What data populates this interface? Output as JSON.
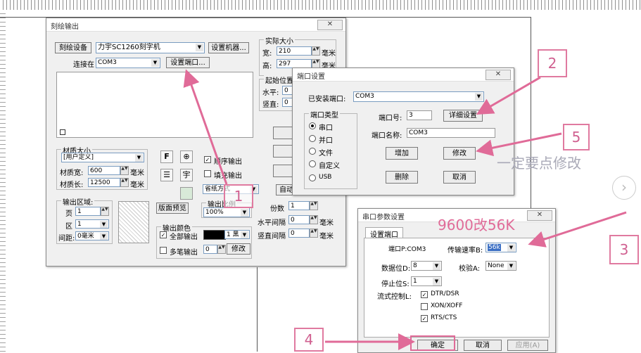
{
  "engrave_dialog": {
    "title": "刻绘输出",
    "device_button": "刻绘设备",
    "device_value": "力宇SC1260刻字机",
    "setup_machine_button": "设置机器...",
    "connect_label": "连接在",
    "port_value": "COM3",
    "setup_port_button": "设置端口...",
    "actual_size_title": "实际大小",
    "width_label": "宽:",
    "width_value": "210",
    "height_label": "高:",
    "height_value": "297",
    "unit_mm": "毫米",
    "start_pos_title": "起始位置",
    "horizontal_label": "水平:",
    "horizontal_value": "0",
    "vertical_label": "竖直:",
    "vertical_value": "0",
    "material_title": "材质大小",
    "material_value": "[用户定义]",
    "material_width_label": "材质宽:",
    "material_width_value": "600",
    "material_length_label": "材质长:",
    "material_length_value": "12500",
    "output_area_title": "输出区域:",
    "page_label": "页",
    "page_value": "1",
    "zone_label": "区",
    "zone_value": "1",
    "gap_label": "间距:",
    "gap_value": "0毫米",
    "preview_button": "版面预览",
    "icon_f": "F",
    "seq_output": "顺序输出",
    "fill_output": "填充输出",
    "icon_letter": "宇",
    "mode_value": "省纸方式",
    "ratio_title": "输出比例",
    "ratio_value": "100%",
    "auto_label": "自动",
    "copies_label": "份数",
    "copies_value": "1",
    "h_gap_label": "水平间隔",
    "h_gap_value": "0",
    "v_gap_label": "竖直间隔",
    "v_gap_value": "0",
    "color_title": "输出颜色",
    "all_output": "全部输出",
    "color_value": "1 黑",
    "multi_output": "多笔输出",
    "multi_value": "0",
    "modify_button": "修改",
    "side_btn1": "刻",
    "side_btn2": "刻绘",
    "side_btn3": "结"
  },
  "port_dialog": {
    "title": "端口设置",
    "installed_label": "已安装端口:",
    "installed_value": "COM3",
    "port_type_title": "端口类型",
    "types": [
      "串口",
      "并口",
      "文件",
      "自定义",
      "USB"
    ],
    "port_no_label": "端口号:",
    "port_no_value": "3",
    "detail_button": "详细设置",
    "port_name_label": "端口名称:",
    "port_name_value": "COM3",
    "add_button": "增加",
    "modify_button": "修改",
    "delete_button": "删除",
    "cancel_button": "取消"
  },
  "serial_dialog": {
    "title": "串口参数设置",
    "tab": "设置端口",
    "port_label": "端口P:COM3",
    "baud_label": "传输速率B:",
    "baud_value": "56k",
    "data_bits_label": "数据位D:",
    "data_bits_value": "8",
    "parity_label": "校验A:",
    "parity_value": "None",
    "stop_bits_label": "停止位S:",
    "stop_bits_value": "1",
    "flow_label": "流式控制L:",
    "flow_options": [
      "DTR/DSR",
      "XON/XOFF",
      "RTS/CTS"
    ],
    "ok_button": "确定",
    "cancel_button": "取消",
    "apply_button": "应用(A)"
  },
  "annotations": {
    "n1": "1",
    "n2": "2",
    "n3": "3",
    "n4": "4",
    "n5": "5",
    "note_baud": "9600改56K",
    "note_modify": "一定要点修改"
  },
  "colors": {
    "annotation": "#e06b98",
    "field_border": "#7a9cc0"
  }
}
